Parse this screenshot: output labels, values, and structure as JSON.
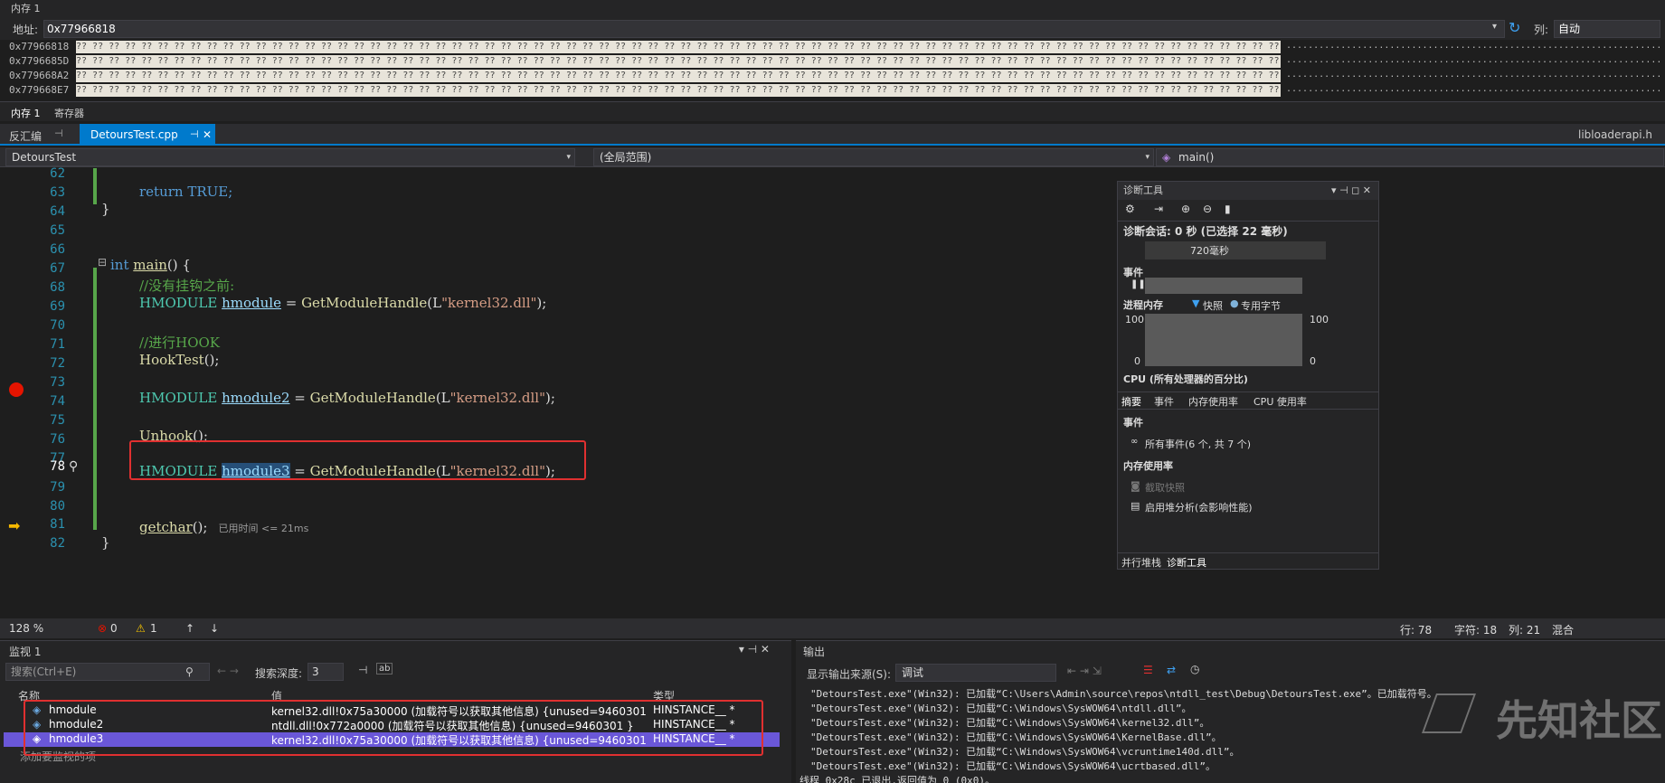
{
  "memory": {
    "title": "内存 1",
    "address_label": "地址:",
    "address_value": "0x77966818",
    "columns_label": "列:",
    "columns_value": "自动",
    "rows": [
      {
        "addr": "0x77966818",
        "bytes": "?? ?? ?? ?? ?? ?? ?? ?? ?? ?? ?? ?? ?? ?? ?? ?? ?? ?? ?? ?? ?? ?? ?? ?? ?? ?? ?? ?? ?? ?? ?? ?? ?? ?? ?? ?? ?? ?? ?? ?? ?? ?? ?? ?? ?? ?? ?? ?? ?? ?? ?? ?? ?? ?? ?? ?? ?? ?? ?? ?? ?? ?? ?? ?? ?? ?? ?? ?? ?? ?? ?? ?? ?? ?? ?? ?? ?? ?? ?? ?? ?? ?? ?? ?? ??",
        "ascii": "....................................................................................."
      },
      {
        "addr": "0x7796685D",
        "bytes": "?? ?? ?? ?? ?? ?? ?? ?? ?? ?? ?? ?? ?? ?? ?? ?? ?? ?? ?? ?? ?? ?? ?? ?? ?? ?? ?? ?? ?? ?? ?? ?? ?? ?? ?? ?? ?? ?? ?? ?? ?? ?? ?? ?? ?? ?? ?? ?? ?? ?? ?? ?? ?? ?? ?? ?? ?? ?? ?? ?? ?? ?? ?? ?? ?? ?? ?? ?? ?? ?? ?? ?? ?? ?? ?? ?? ?? ?? ?? ?? ?? ?? ?? ?? ??",
        "ascii": "....................................................................................."
      },
      {
        "addr": "0x779668A2",
        "bytes": "?? ?? ?? ?? ?? ?? ?? ?? ?? ?? ?? ?? ?? ?? ?? ?? ?? ?? ?? ?? ?? ?? ?? ?? ?? ?? ?? ?? ?? ?? ?? ?? ?? ?? ?? ?? ?? ?? ?? ?? ?? ?? ?? ?? ?? ?? ?? ?? ?? ?? ?? ?? ?? ?? ?? ?? ?? ?? ?? ?? ?? ?? ?? ?? ?? ?? ?? ?? ?? ?? ?? ?? ?? ?? ?? ?? ?? ?? ?? ?? ?? ?? ?? ?? ??",
        "ascii": "....................................................................................."
      },
      {
        "addr": "0x779668E7",
        "bytes": "?? ?? ?? ?? ?? ?? ?? ?? ?? ?? ?? ?? ?? ?? ?? ?? ?? ?? ?? ?? ?? ?? ?? ?? ?? ?? ?? ?? ?? ?? ?? ?? ?? ?? ?? ?? ?? ?? ?? ?? ?? ?? ?? ?? ?? ?? ?? ?? ?? ?? ?? ?? ?? ?? ?? ?? ?? ?? ?? ?? ?? ?? ?? ?? ?? ?? ?? ?? ?? ?? ?? ?? ?? ?? ?? ?? ?? ?? ?? ?? ?? ?? ?? ?? ??",
        "ascii": "....................................................................................."
      }
    ],
    "tabs": [
      "内存 1",
      "寄存器"
    ]
  },
  "editor_tabs": {
    "disasm": "反汇编",
    "file": "DetoursTest.cpp",
    "right_file": "libloaderapi.h"
  },
  "nav": {
    "project": "DetoursTest",
    "scope": "(全局范围)",
    "member": "main()"
  },
  "code": {
    "line_numbers": [
      "62",
      "63",
      "64",
      "65",
      "66",
      "67",
      "68",
      "69",
      "70",
      "71",
      "72",
      "73",
      "74",
      "75",
      "76",
      "77",
      "78",
      "79",
      "80",
      "81",
      "82"
    ],
    "l63": "return TRUE;",
    "l64": "}",
    "l67_kw": "int",
    "l67_fn": "main",
    "l67_rest": "() {",
    "l68": "//没有挂钩之前:",
    "l69_ty": "HMODULE",
    "l69_var": "hmodule",
    "l69_eq": " = ",
    "l69_fn": "GetModuleHandle",
    "l69_open": "(L",
    "l69_str": "\"kernel32.dll\"",
    "l69_close": ");",
    "l71": "//进行HOOK",
    "l72_fn": "HookTest",
    "l72_rest": "();",
    "l74_var": "hmodule2",
    "l76_fn": "Unhook",
    "l76_rest": "();",
    "l78_var": "hmodule3",
    "l81_fn": "getchar",
    "l81_rest": "();",
    "l81_hint": "已用时间 <= 21ms",
    "l82": "}"
  },
  "status": {
    "zoom": "128 %",
    "errors": "0",
    "warnings": "1",
    "line": "行: 78",
    "char": "字符: 18",
    "col": "列: 21",
    "mode": "混合"
  },
  "diag": {
    "title": "诊断工具",
    "session": "诊断会话: 0 秒 (已选择 22 毫秒)",
    "timeline": "720毫秒",
    "events": "事件",
    "proc_mem": "进程内存",
    "snapshot": "快照",
    "private_bytes": "专用字节",
    "y100": "100",
    "y0": "0",
    "cpu": "CPU (所有处理器的百分比)",
    "cpu_100": "100",
    "tabs": [
      "摘要",
      "事件",
      "内存使用率",
      "CPU 使用率"
    ],
    "sec_events": "事件",
    "all_events": "所有事件(6 个, 共 7 个)",
    "sec_mem": "内存使用率",
    "take_snapshot": "截取快照",
    "heap": "启用堆分析(会影响性能)",
    "bottom_tabs": [
      "并行堆栈",
      "诊断工具"
    ]
  },
  "watch": {
    "title": "监视 1",
    "search_placeholder": "搜索(Ctrl+E)",
    "depth_label": "搜索深度:",
    "depth_value": "3",
    "col_name": "名称",
    "col_value": "值",
    "col_type": "类型",
    "rows": [
      {
        "name": "hmodule",
        "value": "kernel32.dll!0x75a30000 (加载符号以获取其他信息) {unused=9460301 }",
        "type": "HINSTANCE__ *"
      },
      {
        "name": "hmodule2",
        "value": "ntdll.dll!0x772a0000 (加载符号以获取其他信息) {unused=9460301 }",
        "type": "HINSTANCE__ *"
      },
      {
        "name": "hmodule3",
        "value": "kernel32.dll!0x75a30000 (加载符号以获取其他信息) {unused=9460301 }",
        "type": "HINSTANCE__ *"
      }
    ],
    "add_item": "添加要监视的项"
  },
  "output": {
    "title": "输出",
    "source_label": "显示输出来源(S):",
    "source_value": "调试",
    "lines": [
      "\"DetoursTest.exe\"(Win32): 已加载“C:\\Users\\Admin\\source\\repos\\ntdll_test\\Debug\\DetoursTest.exe”。已加载符号。",
      "\"DetoursTest.exe\"(Win32): 已加载“C:\\Windows\\SysWOW64\\ntdll.dll”。",
      "\"DetoursTest.exe\"(Win32): 已加载“C:\\Windows\\SysWOW64\\kernel32.dll”。",
      "\"DetoursTest.exe\"(Win32): 已加载“C:\\Windows\\SysWOW64\\KernelBase.dll”。",
      "\"DetoursTest.exe\"(Win32): 已加载“C:\\Windows\\SysWOW64\\vcruntime140d.dll”。",
      "\"DetoursTest.exe\"(Win32): 已加载“C:\\Windows\\SysWOW64\\ucrtbased.dll”。",
      "线程 0x28c 已退出,返回值为 0 (0x0)。"
    ],
    "watermark": "先知社区"
  }
}
